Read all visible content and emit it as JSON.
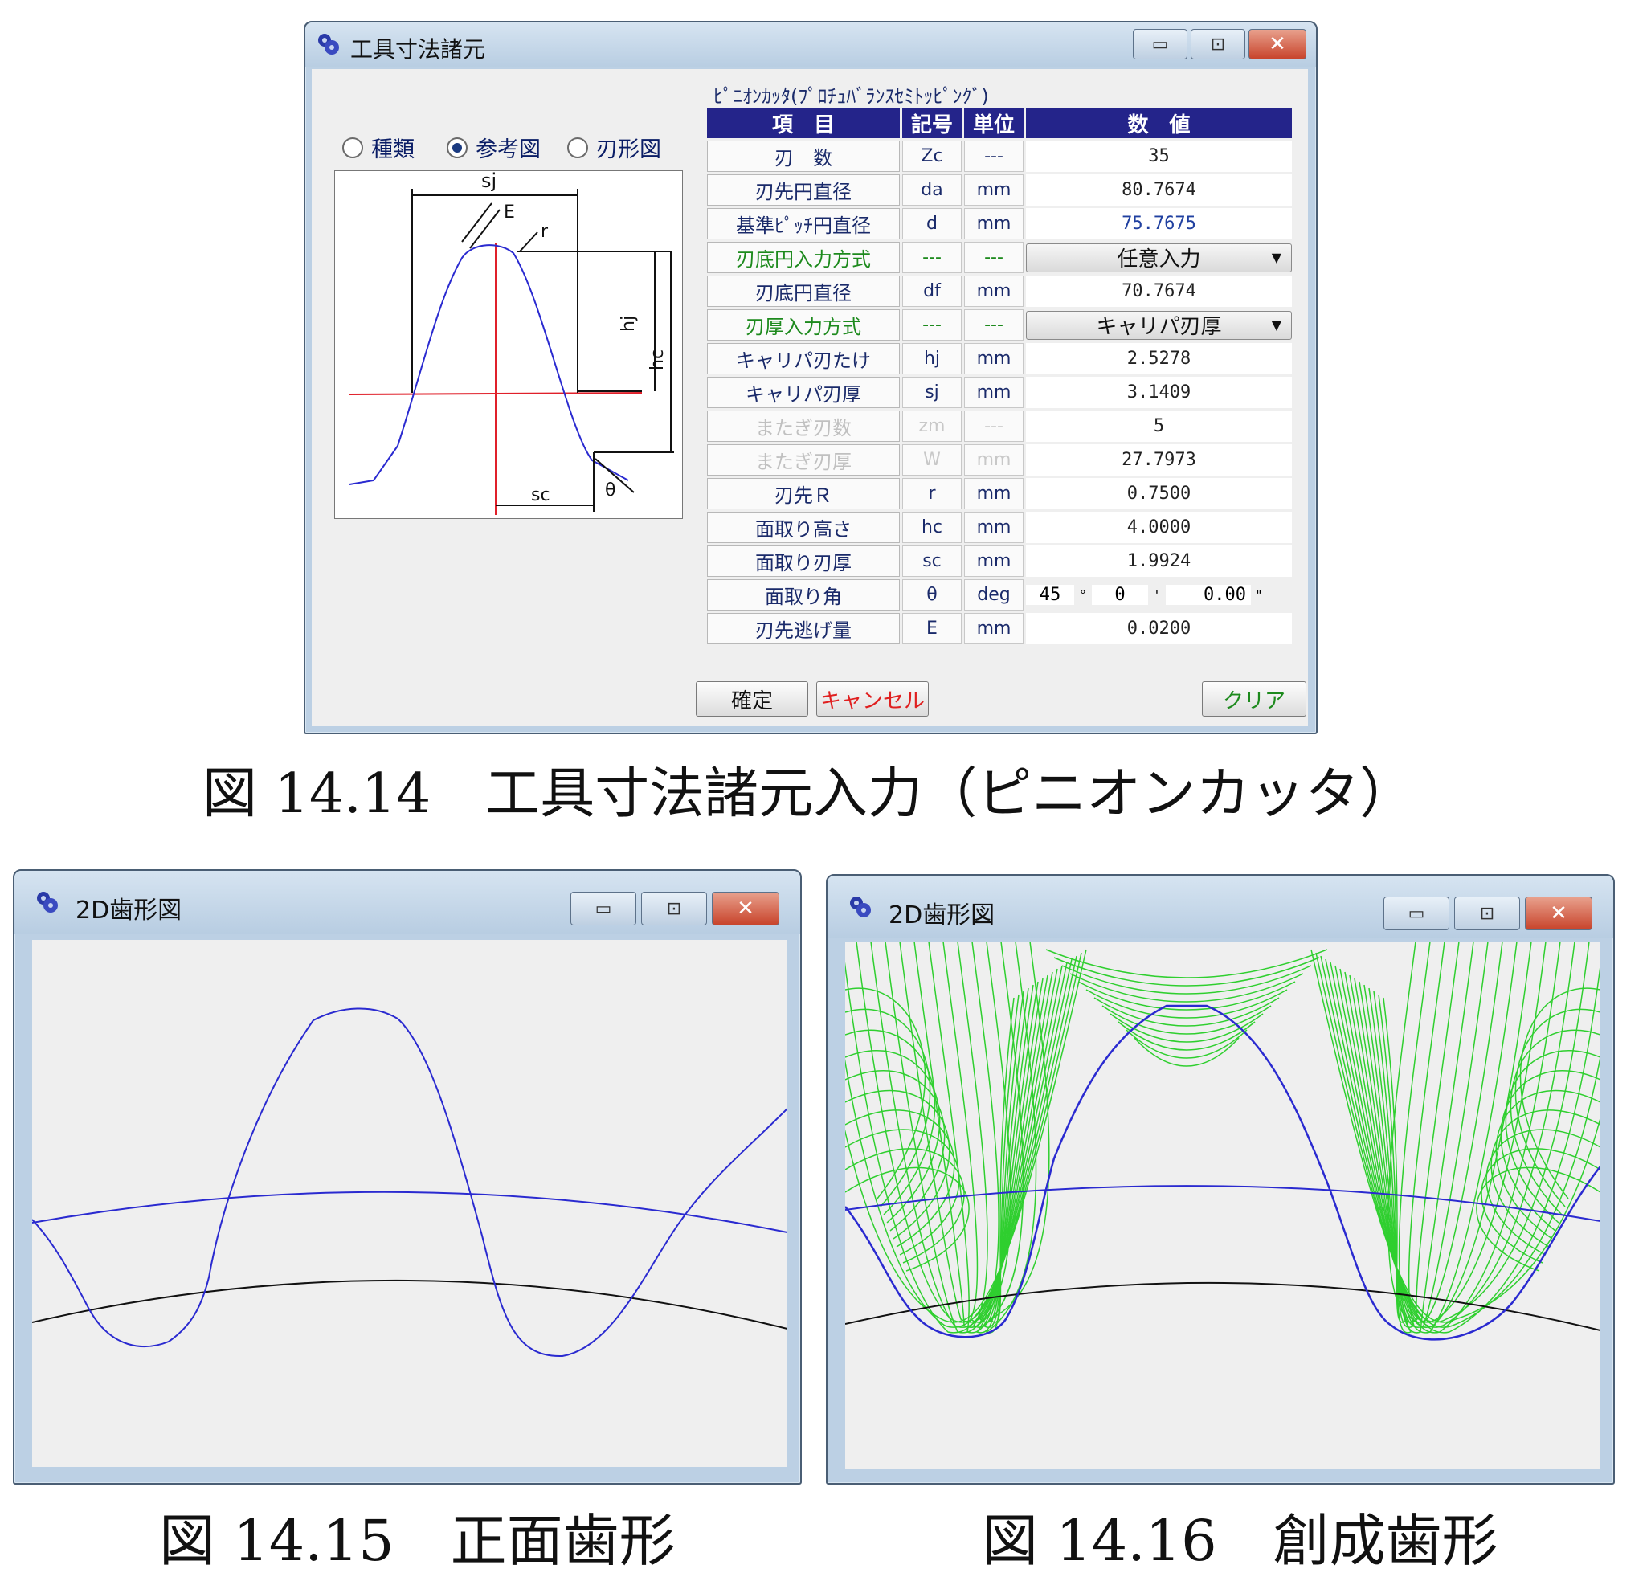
{
  "dialog": {
    "title": "工具寸法諸元",
    "subtitle": "ﾋﾟﾆｵﾝｶｯﾀ(ﾌﾟﾛﾁｭﾊﾞﾗﾝｽｾﾐﾄｯﾋﾟﾝｸﾞ)",
    "radios": [
      {
        "label": "種類",
        "selected": false
      },
      {
        "label": "参考図",
        "selected": true
      },
      {
        "label": "刃形図",
        "selected": false
      }
    ],
    "figure_labels": {
      "sj": "sj",
      "E": "E",
      "r": "r",
      "hj": "hj",
      "hc": "hc",
      "sc": "sc",
      "theta": "θ"
    },
    "headers": [
      "項　目",
      "記号",
      "単位",
      "数　値"
    ],
    "rows": [
      {
        "label": "刃　数",
        "symbol": "Zc",
        "unit": "---",
        "value": "35"
      },
      {
        "label": "刃先円直径",
        "symbol": "da",
        "unit": "mm",
        "value": "80.7674"
      },
      {
        "label": "基準ﾋﾟｯﾁ円直径",
        "symbol": "d",
        "unit": "mm",
        "value": "75.7675"
      },
      {
        "label": "刃底円入力方式",
        "symbol": "---",
        "unit": "---",
        "value": "任意入力"
      },
      {
        "label": "刃底円直径",
        "symbol": "df",
        "unit": "mm",
        "value": "70.7674"
      },
      {
        "label": "刃厚入力方式",
        "symbol": "---",
        "unit": "---",
        "value": "キャリパ刃厚"
      },
      {
        "label": "キャリパ刃たけ",
        "symbol": "hj",
        "unit": "mm",
        "value": "2.5278"
      },
      {
        "label": "キャリパ刃厚",
        "symbol": "sj",
        "unit": "mm",
        "value": "3.1409"
      },
      {
        "label": "またぎ刃数",
        "symbol": "zm",
        "unit": "---",
        "value": "5"
      },
      {
        "label": "またぎ刃厚",
        "symbol": "W",
        "unit": "mm",
        "value": "27.7973"
      },
      {
        "label": "刃先Ｒ",
        "symbol": "r",
        "unit": "mm",
        "value": "0.7500"
      },
      {
        "label": "面取り高さ",
        "symbol": "hc",
        "unit": "mm",
        "value": "4.0000"
      },
      {
        "label": "面取り刃厚",
        "symbol": "sc",
        "unit": "mm",
        "value": "1.9924"
      },
      {
        "label": "面取り角",
        "symbol": "θ",
        "unit": "deg",
        "deg": "45",
        "min": "0",
        "sec": "0.00"
      },
      {
        "label": "刃先逃げ量",
        "symbol": "E",
        "unit": "mm",
        "value": "0.0200"
      }
    ],
    "angle_units": {
      "deg": "°",
      "min": "'",
      "sec": "\""
    },
    "buttons": {
      "ok": "確定",
      "cancel": "キャンセル",
      "clear": "クリア"
    }
  },
  "captions": {
    "fig14": "図 14.14　工具寸法諸元入力（ピニオンカッタ）",
    "fig15": "図 14.15　正面歯形",
    "fig16": "図 14.16　創成歯形"
  },
  "win2d": {
    "title": "2D歯形図"
  },
  "window_controls": {
    "minimize": "▭",
    "maximize": "⊡",
    "close": "✕"
  },
  "colors": {
    "profile": "#2a2ad0",
    "generated": "#2fcf2f",
    "base_circle": "#111111",
    "ref_red": "#e0202a",
    "header_bg": "#24248a"
  }
}
